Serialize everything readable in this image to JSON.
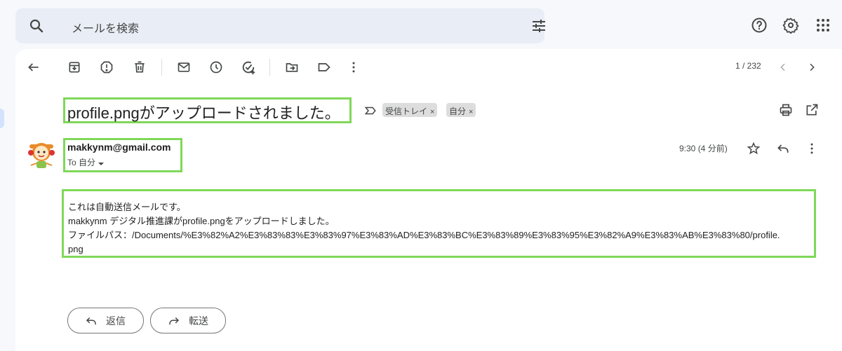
{
  "search": {
    "placeholder": "メールを検索"
  },
  "toolbar": {
    "pager": "1 / 232"
  },
  "message": {
    "subject": "profile.pngがアップロードされました。",
    "labels": [
      "受信トレイ",
      "自分"
    ],
    "label_close": "×",
    "sender": "makkynm@gmail.com",
    "recipient": "To 自分",
    "time": "9:30 (4 分前)",
    "body": [
      "これは自動送信メールです。",
      "makkynm デジタル推進課がprofile.pngをアップロードしました。",
      "ファイルパス：/Documents/%E3%82%A2%E3%83%83%E3%83%97%E3%83%AD%E3%83%BC%E3%83%89%E3%83%95%E3%82%A9%E3%83%AB%E3%83%80/profile.",
      "png"
    ]
  },
  "actions": {
    "reply": "返信",
    "forward": "転送"
  },
  "colors": {
    "highlight": "#7fd859",
    "search_bg": "#e9eef6",
    "page_bg": "#f6f8fc"
  },
  "icons": [
    "search-icon",
    "filter-icon",
    "help-icon",
    "settings-icon",
    "apps-icon",
    "back-icon",
    "archive-icon",
    "report-spam-icon",
    "delete-icon",
    "mark-unread-icon",
    "snooze-icon",
    "add-task-icon",
    "move-to-icon",
    "label-icon",
    "more-icon",
    "prev-icon",
    "next-icon",
    "important-icon",
    "print-icon",
    "open-new-window-icon",
    "star-icon",
    "reply-icon",
    "forward-icon"
  ]
}
